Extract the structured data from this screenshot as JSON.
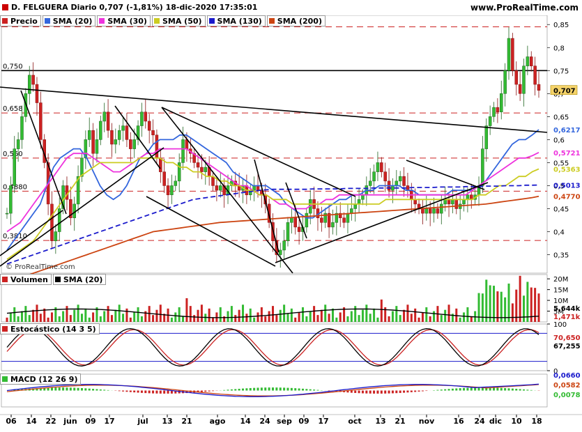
{
  "header": {
    "title": "D. FELGUERA Diario 0,707 (-1,81%) 18-dic-2020 17:35:01",
    "site": "www.ProRealTime.com"
  },
  "price_panel": {
    "legend": [
      {
        "label": "Precio",
        "color": "#cc2222"
      },
      {
        "label": "SMA (20)",
        "color": "#3366dd"
      },
      {
        "label": "SMA (30)",
        "color": "#ee33dd"
      },
      {
        "label": "SMA (50)",
        "color": "#cccc22"
      },
      {
        "label": "SMA (130)",
        "color": "#1a1acc"
      },
      {
        "label": "SMA (200)",
        "color": "#cc4411"
      }
    ],
    "watermark": "© ProRealTime.com",
    "left_levels": [
      "0,845",
      "0,750",
      "0,658",
      "0,560",
      "0,4880",
      "0,3810"
    ],
    "right_labels": [
      {
        "text": "0,707",
        "color": "#000000",
        "bg": "#f5d36a"
      },
      {
        "text": "0,6217",
        "color": "#3366dd"
      },
      {
        "text": "0,5721",
        "color": "#ee33dd"
      },
      {
        "text": "0,5363",
        "color": "#cccc22"
      },
      {
        "text": "0,5013",
        "color": "#1a1acc"
      },
      {
        "text": "0,4770",
        "color": "#cc4411"
      }
    ]
  },
  "volume_panel": {
    "legend": [
      {
        "label": "Volumen",
        "color": "#cc2222"
      },
      {
        "label": "SMA (20)",
        "color": "#000000"
      }
    ],
    "ticks": [
      "20M",
      "15M",
      "10M",
      "5M"
    ],
    "right_labels": [
      {
        "text": "5,644k",
        "color": "#000000"
      },
      {
        "text": "1,471k",
        "color": "#cc2222"
      }
    ]
  },
  "stoch_panel": {
    "legend": [
      {
        "label": "Estocástico (14 3 5)",
        "color": "#cc2222"
      }
    ],
    "ticks": [
      "100",
      "0"
    ],
    "right_labels": [
      {
        "text": "70,650",
        "color": "#cc2222"
      },
      {
        "text": "67,255",
        "color": "#000000"
      }
    ]
  },
  "macd_panel": {
    "legend": [
      {
        "label": "MACD (12 26 9)",
        "color": "#33bb33"
      }
    ],
    "right_labels": [
      {
        "text": "0,0660",
        "color": "#1a1acc"
      },
      {
        "text": "0,0582",
        "color": "#cc4411"
      },
      {
        "text": "0,0078",
        "color": "#33bb33"
      }
    ]
  },
  "x_axis_labels": [
    "06",
    "14",
    "22",
    "jun",
    "09",
    "17",
    "jul",
    "13",
    "21",
    "ago",
    "14",
    "24",
    "sep",
    "09",
    "17",
    "oct",
    "13",
    "21",
    "nov",
    "16",
    "24",
    "dic",
    "10",
    "18"
  ],
  "chart_data": {
    "type": "candlestick",
    "title": "D. FELGUERA Diario",
    "y_ticks": [
      0.35,
      0.4,
      0.45,
      0.5,
      0.55,
      0.6,
      0.65,
      0.7,
      0.75,
      0.8,
      0.85
    ],
    "ylim": [
      0.31,
      0.87
    ],
    "closes": [
      0.44,
      0.5,
      0.58,
      0.6,
      0.65,
      0.7,
      0.74,
      0.72,
      0.68,
      0.6,
      0.55,
      0.46,
      0.38,
      0.4,
      0.45,
      0.5,
      0.47,
      0.43,
      0.46,
      0.52,
      0.56,
      0.6,
      0.62,
      0.57,
      0.6,
      0.64,
      0.66,
      0.62,
      0.59,
      0.6,
      0.62,
      0.63,
      0.6,
      0.58,
      0.6,
      0.63,
      0.66,
      0.64,
      0.62,
      0.61,
      0.56,
      0.53,
      0.5,
      0.48,
      0.5,
      0.51,
      0.55,
      0.6,
      0.58,
      0.57,
      0.55,
      0.54,
      0.53,
      0.54,
      0.52,
      0.5,
      0.49,
      0.5,
      0.48,
      0.5,
      0.51,
      0.5,
      0.49,
      0.5,
      0.48,
      0.49,
      0.5,
      0.49,
      0.48,
      0.46,
      0.42,
      0.38,
      0.35,
      0.36,
      0.38,
      0.42,
      0.43,
      0.41,
      0.4,
      0.41,
      0.44,
      0.47,
      0.45,
      0.43,
      0.42,
      0.44,
      0.41,
      0.42,
      0.44,
      0.43,
      0.42,
      0.44,
      0.45,
      0.46,
      0.47,
      0.48,
      0.5,
      0.51,
      0.53,
      0.55,
      0.53,
      0.51,
      0.49,
      0.5,
      0.51,
      0.52,
      0.5,
      0.49,
      0.47,
      0.46,
      0.45,
      0.44,
      0.45,
      0.44,
      0.45,
      0.44,
      0.46,
      0.47,
      0.46,
      0.47,
      0.45,
      0.46,
      0.47,
      0.48,
      0.47,
      0.48,
      0.5,
      0.58,
      0.63,
      0.65,
      0.67,
      0.66,
      0.7,
      0.75,
      0.82,
      0.75,
      0.72,
      0.7,
      0.76,
      0.78,
      0.76,
      0.72,
      0.707
    ],
    "series": [
      {
        "name": "SMA (20)",
        "color": "#3366dd",
        "values": [
          0.36,
          0.38,
          0.4,
          0.42,
          0.44,
          0.46,
          0.5,
          0.54,
          0.56,
          0.57,
          0.58,
          0.58,
          0.56,
          0.53,
          0.5,
          0.48,
          0.47,
          0.48,
          0.5,
          0.53,
          0.56,
          0.57,
          0.59,
          0.6,
          0.6,
          0.6,
          0.61,
          0.61,
          0.6,
          0.59,
          0.58,
          0.57,
          0.56,
          0.55,
          0.53,
          0.52,
          0.51,
          0.5,
          0.5,
          0.5,
          0.49,
          0.48,
          0.46,
          0.45,
          0.44,
          0.43,
          0.43,
          0.44,
          0.45,
          0.46,
          0.47,
          0.47,
          0.48,
          0.48,
          0.49,
          0.49,
          0.5,
          0.5,
          0.5,
          0.5,
          0.49,
          0.49,
          0.48,
          0.48,
          0.48,
          0.48,
          0.48,
          0.49,
          0.49,
          0.49,
          0.49,
          0.5,
          0.51,
          0.53,
          0.55,
          0.57,
          0.59,
          0.6,
          0.6,
          0.61,
          0.6217
        ]
      },
      {
        "name": "SMA (30)",
        "color": "#ee33dd",
        "values": [
          0.4,
          0.41,
          0.42,
          0.44,
          0.46,
          0.48,
          0.5,
          0.52,
          0.54,
          0.56,
          0.57,
          0.57,
          0.57,
          0.56,
          0.55,
          0.54,
          0.53,
          0.53,
          0.54,
          0.55,
          0.56,
          0.57,
          0.57,
          0.58,
          0.58,
          0.58,
          0.58,
          0.58,
          0.57,
          0.56,
          0.55,
          0.54,
          0.53,
          0.52,
          0.51,
          0.5,
          0.5,
          0.49,
          0.48,
          0.48,
          0.47,
          0.46,
          0.46,
          0.45,
          0.45,
          0.45,
          0.46,
          0.46,
          0.47,
          0.47,
          0.48,
          0.48,
          0.48,
          0.48,
          0.48,
          0.48,
          0.48,
          0.48,
          0.48,
          0.48,
          0.48,
          0.48,
          0.48,
          0.48,
          0.48,
          0.48,
          0.48,
          0.48,
          0.48,
          0.48,
          0.49,
          0.5,
          0.51,
          0.52,
          0.53,
          0.54,
          0.55,
          0.56,
          0.56,
          0.565,
          0.5721
        ]
      },
      {
        "name": "SMA (50)",
        "color": "#cccc22",
        "values": [
          0.34,
          0.35,
          0.36,
          0.37,
          0.38,
          0.4,
          0.42,
          0.44,
          0.46,
          0.48,
          0.5,
          0.52,
          0.53,
          0.54,
          0.55,
          0.55,
          0.55,
          0.55,
          0.55,
          0.55,
          0.56,
          0.56,
          0.56,
          0.56,
          0.55,
          0.55,
          0.54,
          0.54,
          0.53,
          0.53,
          0.52,
          0.52,
          0.51,
          0.51,
          0.5,
          0.5,
          0.49,
          0.49,
          0.48,
          0.48,
          0.47,
          0.47,
          0.47,
          0.46,
          0.46,
          0.46,
          0.46,
          0.46,
          0.46,
          0.46,
          0.46,
          0.46,
          0.46,
          0.46,
          0.46,
          0.46,
          0.46,
          0.47,
          0.47,
          0.47,
          0.47,
          0.47,
          0.47,
          0.47,
          0.47,
          0.47,
          0.47,
          0.47,
          0.47,
          0.47,
          0.47,
          0.48,
          0.48,
          0.49,
          0.5,
          0.5,
          0.51,
          0.52,
          0.52,
          0.53,
          0.5363
        ]
      },
      {
        "name": "SMA (130)",
        "color": "#1a1acc",
        "dashed": true,
        "values": [
          0.33,
          0.335,
          0.34,
          0.345,
          0.35,
          0.355,
          0.36,
          0.365,
          0.37,
          0.375,
          0.38,
          0.385,
          0.39,
          0.395,
          0.4,
          0.405,
          0.41,
          0.415,
          0.42,
          0.425,
          0.43,
          0.435,
          0.44,
          0.445,
          0.45,
          0.455,
          0.46,
          0.465,
          0.47,
          0.472,
          0.474,
          0.476,
          0.478,
          0.48,
          0.482,
          0.484,
          0.486,
          0.488,
          0.49,
          0.491,
          0.492,
          0.492,
          0.492,
          0.492,
          0.492,
          0.492,
          0.493,
          0.493,
          0.493,
          0.493,
          0.493,
          0.494,
          0.494,
          0.494,
          0.494,
          0.495,
          0.495,
          0.495,
          0.495,
          0.495,
          0.495,
          0.496,
          0.496,
          0.496,
          0.496,
          0.497,
          0.497,
          0.497,
          0.497,
          0.498,
          0.498,
          0.498,
          0.499,
          0.499,
          0.499,
          0.5,
          0.5,
          0.5,
          0.501,
          0.501,
          0.5013
        ]
      },
      {
        "name": "SMA (200)",
        "color": "#cc4411",
        "values": [
          0.29,
          0.295,
          0.3,
          0.305,
          0.31,
          0.315,
          0.32,
          0.325,
          0.33,
          0.335,
          0.34,
          0.345,
          0.35,
          0.355,
          0.36,
          0.365,
          0.37,
          0.375,
          0.38,
          0.385,
          0.39,
          0.395,
          0.4,
          0.402,
          0.404,
          0.406,
          0.408,
          0.41,
          0.412,
          0.414,
          0.416,
          0.418,
          0.42,
          0.421,
          0.422,
          0.423,
          0.424,
          0.425,
          0.426,
          0.427,
          0.428,
          0.429,
          0.43,
          0.431,
          0.432,
          0.433,
          0.434,
          0.435,
          0.436,
          0.437,
          0.438,
          0.439,
          0.44,
          0.441,
          0.442,
          0.443,
          0.444,
          0.445,
          0.446,
          0.447,
          0.448,
          0.449,
          0.45,
          0.451,
          0.452,
          0.453,
          0.454,
          0.455,
          0.456,
          0.457,
          0.458,
          0.459,
          0.46,
          0.462,
          0.464,
          0.466,
          0.468,
          0.47,
          0.472,
          0.474,
          0.477
        ]
      }
    ]
  }
}
